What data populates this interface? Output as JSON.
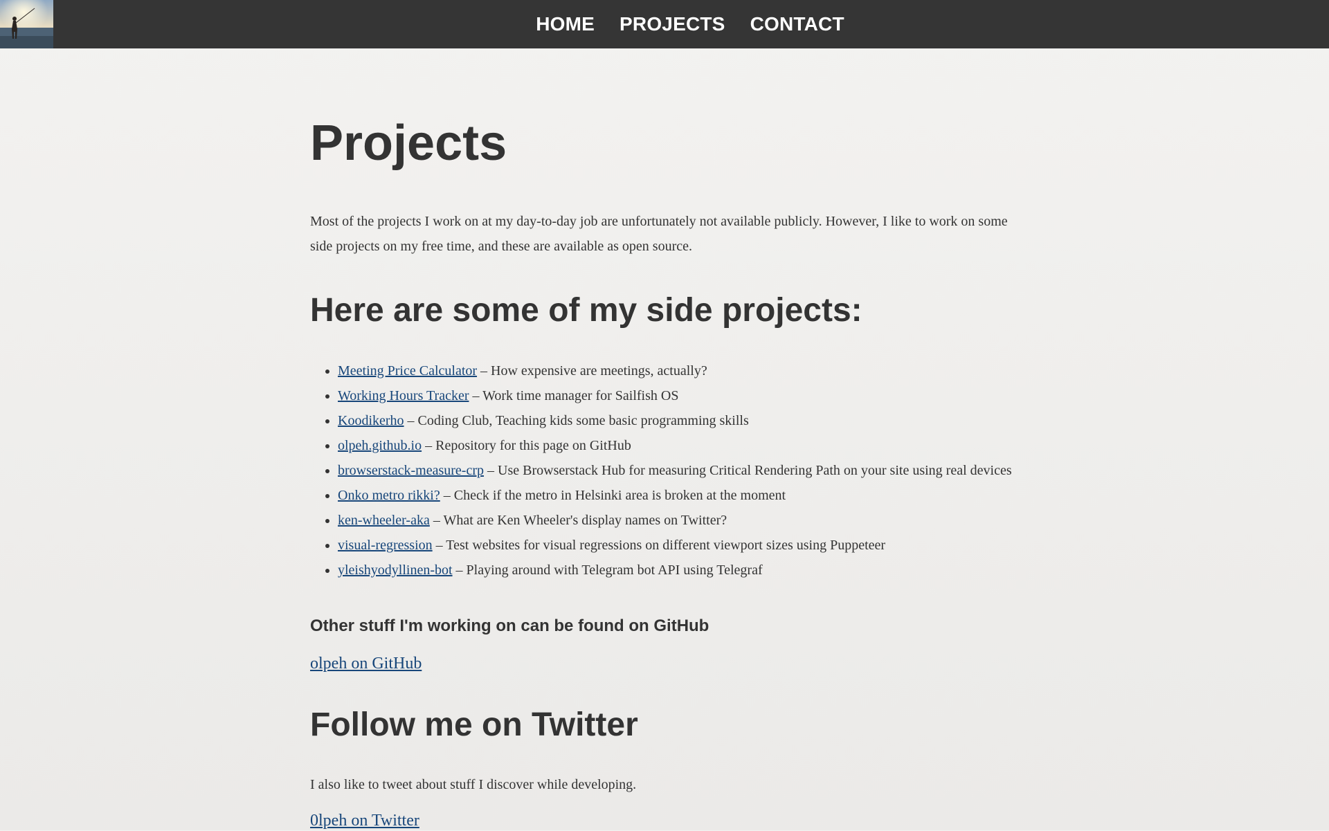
{
  "nav": {
    "logo_alt": "logo",
    "items": [
      {
        "label": "HOME"
      },
      {
        "label": "PROJECTS"
      },
      {
        "label": "CONTACT"
      }
    ]
  },
  "main": {
    "title": "Projects",
    "intro": "Most of the projects I work on at my day-to-day job are unfortunately not available publicly. However, I like to work on some side projects on my free time, and these are available as open source.",
    "side_heading": "Here are some of my side projects:",
    "projects": [
      {
        "name": "Meeting Price Calculator",
        "desc": " – How expensive are meetings, actually?"
      },
      {
        "name": "Working Hours Tracker",
        "desc": " – Work time manager for Sailfish OS"
      },
      {
        "name": "Koodikerho",
        "desc": " – Coding Club, Teaching kids some basic programming skills"
      },
      {
        "name": "olpeh.github.io",
        "desc": " – Repository for this page on GitHub"
      },
      {
        "name": "browserstack-measure-crp",
        "desc": " – Use Browserstack Hub for measuring Critical Rendering Path on your site using real devices"
      },
      {
        "name": "Onko metro rikki?",
        "desc": " – Check if the metro in Helsinki area is broken at the moment"
      },
      {
        "name": "ken-wheeler-aka",
        "desc": " – What are Ken Wheeler's display names on Twitter?"
      },
      {
        "name": "visual-regression",
        "desc": " – Test websites for visual regressions on different viewport sizes using Puppeteer"
      },
      {
        "name": "yleishyodyllinen-bot",
        "desc": " – Playing around with Telegram bot API using Telegraf"
      }
    ],
    "other_heading": "Other stuff I'm working on can be found on GitHub",
    "github_link": "olpeh on GitHub",
    "twitter_heading": "Follow me on Twitter",
    "tweet_text": "I also like to tweet about stuff I discover while developing.",
    "twitter_link": "0lpeh on Twitter"
  },
  "colors": {
    "topbar": "#353535",
    "link": "#17467a",
    "text": "#333333",
    "background": "#f3f2f0"
  }
}
